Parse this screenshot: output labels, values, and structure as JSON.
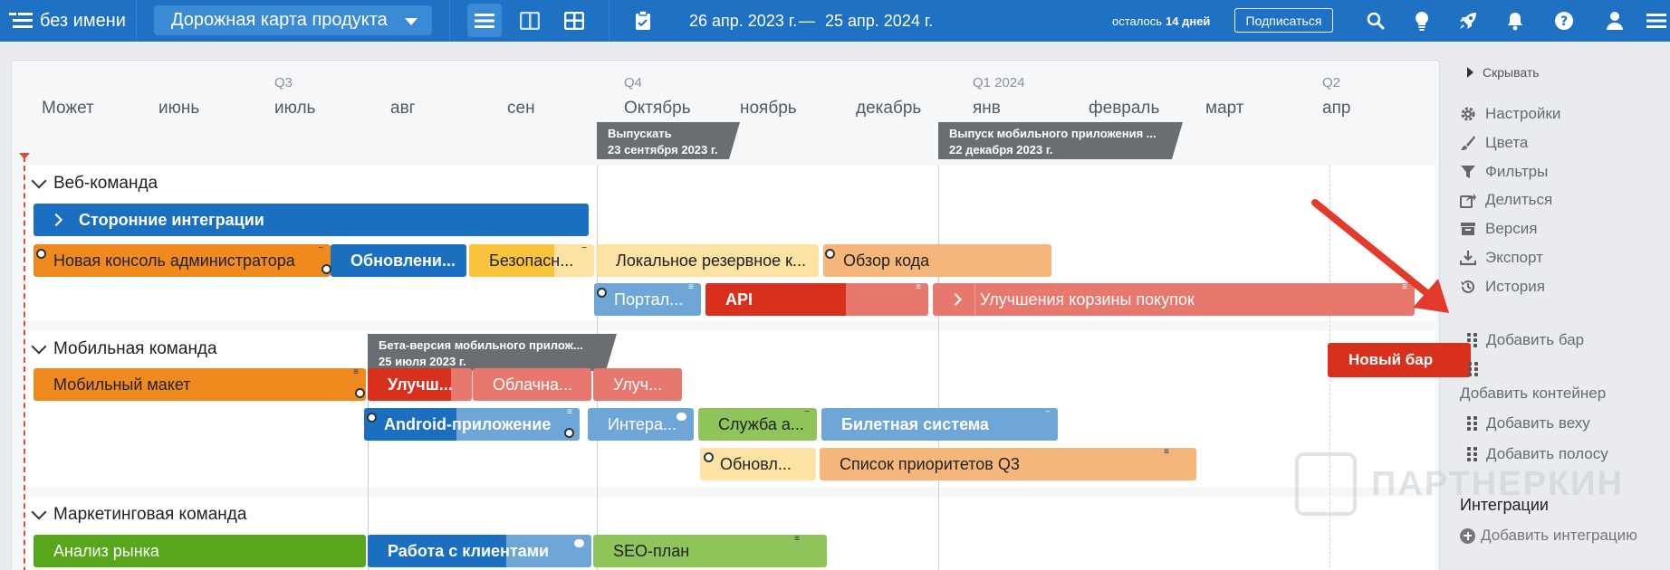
{
  "topbar": {
    "title": "без имени",
    "roadmap_select": "Дорожная карта продукта",
    "date_start": "26 апр. 2023 г.",
    "date_dash": "—",
    "date_end": "25 апр. 2024 г.",
    "trial_prefix": "осталось",
    "trial_days": "14 дней",
    "subscribe": "Подписаться"
  },
  "timeline": {
    "quarters": [
      "Q3",
      "Q4",
      "Q1 2024",
      "Q2"
    ],
    "months": [
      "Может",
      "июнь",
      "июль",
      "авг",
      "сен",
      "Октябрь",
      "ноябрь",
      "декабрь",
      "янв",
      "февраль",
      "март",
      "апр"
    ]
  },
  "milestones": [
    {
      "title": "Выпускать",
      "date": "23 сентября 2023 г."
    },
    {
      "title": "Выпуск мобильного приложения ...",
      "date": "22 декабря 2023 г."
    },
    {
      "title": "Бета-версия мобильного прилож...",
      "date": "25 июля 2023 г."
    }
  ],
  "groups": [
    {
      "name": "Веб-команда"
    },
    {
      "name": "Мобильная команда"
    },
    {
      "name": "Маркетинговая команда"
    }
  ],
  "bars": {
    "web": [
      "Сторонние интеграции",
      "Новая консоль администратора",
      "Обновлени...",
      "Безопасн...",
      "Локальное резервное к...",
      "Обзор кода",
      "Портал...",
      "API",
      "Улучшения корзины покупок"
    ],
    "mobile": [
      "Мобильный макет",
      "Улучш...",
      "Облачна...",
      "Улуч...",
      "Android-приложение",
      "Интера...",
      "Служба а...",
      "Билетная система",
      "Обновл...",
      "Список приоритетов Q3"
    ],
    "marketing": [
      "Анализ рынка",
      "Работа с клиентами",
      "SEO-план"
    ]
  },
  "sidepanel": {
    "hide": "Скрывать",
    "settings": "Настройки",
    "colors": "Цвета",
    "filters": "Фильтры",
    "share": "Делиться",
    "version": "Версия",
    "export": "Экспорт",
    "history": "История",
    "add_bar": "Добавить бар",
    "new_bar": "Новый бар",
    "add_container": "Добавить контейнер",
    "add_milestone": "Добавить веху",
    "add_swimlane": "Добавить полосу",
    "integrations": "Интеграции",
    "add_integration": "Добавить интеграцию"
  },
  "watermark": "ПАРТНЕРКИН",
  "colors": {
    "topbar": "#1f72c3",
    "blue_dark": "#1a6fc0",
    "blue_light": "#6ea6d8",
    "orange": "#f08a1f",
    "orange_light": "#f6b67a",
    "yellow": "#f9c33c",
    "yellow_light": "#fde3a3",
    "red": "#d9301d",
    "red_light": "#e8776d",
    "green_dark": "#58a61c",
    "green_light": "#8fc45a"
  }
}
